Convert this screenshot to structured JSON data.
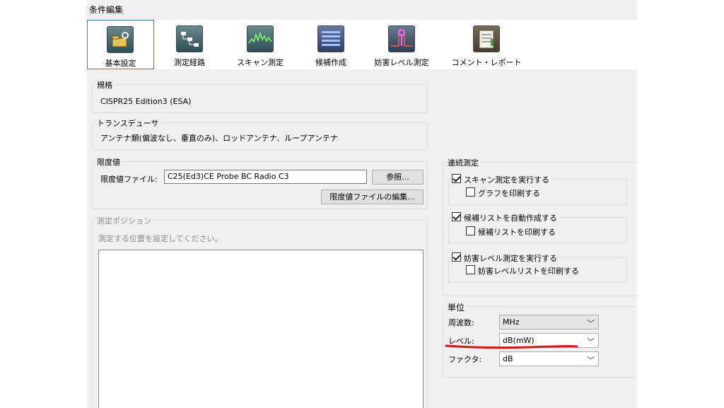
{
  "window": {
    "title": "条件編集"
  },
  "toolbar": {
    "tabs": [
      {
        "label": "基本設定",
        "icon": "folder-settings-icon",
        "active": true
      },
      {
        "label": "測定経路",
        "icon": "path-diagram-icon",
        "active": false
      },
      {
        "label": "スキャン測定",
        "icon": "scan-waveform-icon",
        "active": false
      },
      {
        "label": "候補作成",
        "icon": "candidate-list-icon",
        "active": false
      },
      {
        "label": "妨害レベル測定",
        "icon": "disturbance-level-icon",
        "active": false
      },
      {
        "label": "コメント・レポート",
        "icon": "report-icon",
        "active": false
      }
    ]
  },
  "standard": {
    "legend": "規格",
    "value": "CISPR25 Edition3 (ESA)"
  },
  "transducer": {
    "legend": "トランスデューサ",
    "value": "アンテナ類(偏波なし、垂直のみ)、ロッドアンテナ、ループアンテナ"
  },
  "limit": {
    "legend": "限度値",
    "file_label": "限度値ファイル:",
    "file_value": "C25(Ed3)CE Probe BC Radio C3",
    "browse_button": "参照...",
    "edit_button": "限度値ファイルの編集..."
  },
  "position": {
    "legend": "測定ポジション",
    "hint": "測定する位置を設定してください。"
  },
  "continuous": {
    "legend": "連続測定",
    "scan": {
      "label": "スキャン測定を実行する",
      "checked": true,
      "sub_label": "グラフを印刷する",
      "sub_checked": false
    },
    "candidate": {
      "label": "候補リストを自動作成する",
      "checked": true,
      "sub_label": "候補リストを印刷する",
      "sub_checked": false
    },
    "disturbance": {
      "label": "妨害レベル測定を実行する",
      "checked": true,
      "sub_label": "妨害レベルリストを印刷する",
      "sub_checked": false
    }
  },
  "units": {
    "legend": "単位",
    "frequency": {
      "label": "周波数:",
      "value": "MHz"
    },
    "level": {
      "label": "レベル:",
      "value": "dB(mW)"
    },
    "factor": {
      "label": "ファクタ:",
      "value": "dB"
    }
  },
  "colors": {
    "highlight_underline": "#e0101a",
    "active_tab_border": "#3c7fb1"
  }
}
